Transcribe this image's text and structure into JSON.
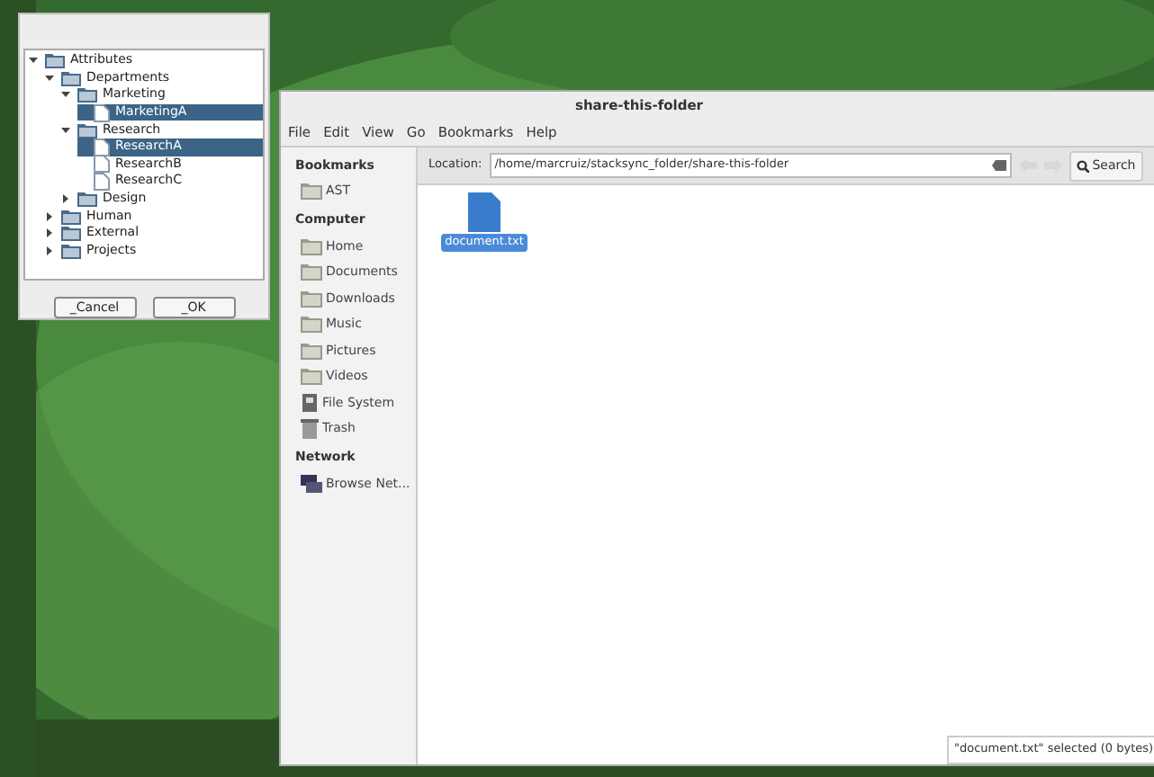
{
  "tree_dialog": {
    "tree": [
      {
        "label": "Attributes",
        "kind": "folder",
        "expanded": true,
        "selected": false,
        "children": [
          {
            "label": "Departments",
            "kind": "folder",
            "expanded": true,
            "selected": false,
            "children": [
              {
                "label": "Marketing",
                "kind": "folder",
                "expanded": true,
                "selected": false,
                "children": [
                  {
                    "label": "MarketingA",
                    "kind": "file",
                    "selected": true
                  }
                ]
              },
              {
                "label": "Research",
                "kind": "folder",
                "expanded": true,
                "selected": false,
                "children": [
                  {
                    "label": "ResearchA",
                    "kind": "file",
                    "selected": true
                  },
                  {
                    "label": "ResearchB",
                    "kind": "file",
                    "selected": false
                  },
                  {
                    "label": "ResearchC",
                    "kind": "file",
                    "selected": false
                  }
                ]
              },
              {
                "label": "Design",
                "kind": "folder",
                "expanded": false,
                "selected": false
              }
            ]
          },
          {
            "label": "Human",
            "kind": "folder",
            "expanded": false,
            "selected": false
          },
          {
            "label": "External",
            "kind": "folder",
            "expanded": false,
            "selected": false
          },
          {
            "label": "Projects",
            "kind": "folder",
            "expanded": false,
            "selected": false
          }
        ]
      }
    ],
    "buttons": [
      "_Cancel",
      "_OK"
    ]
  },
  "file_manager": {
    "title": "share-this-folder",
    "menu": [
      "File",
      "Edit",
      "View",
      "Go",
      "Bookmarks",
      "Help"
    ],
    "sidebar": [
      {
        "heading": "Bookmarks",
        "items": [
          {
            "label": "AST",
            "kind": "folder"
          }
        ]
      },
      {
        "heading": "Computer",
        "items": [
          {
            "label": "Home",
            "kind": "folder"
          },
          {
            "label": "Documents",
            "kind": "folder"
          },
          {
            "label": "Downloads",
            "kind": "folder"
          },
          {
            "label": "Music",
            "kind": "folder"
          },
          {
            "label": "Pictures",
            "kind": "folder"
          },
          {
            "label": "Videos",
            "kind": "folder"
          },
          {
            "label": "File System",
            "kind": "drive"
          },
          {
            "label": "Trash",
            "kind": "trash"
          }
        ]
      },
      {
        "heading": "Network",
        "items": [
          {
            "label": "Browse Net...",
            "kind": "network"
          }
        ]
      }
    ],
    "location_label": "Location:",
    "location": "/home/marcruiz/stacksync_folder/share-this-folder",
    "search": "Search",
    "files": [
      {
        "name": "document.txt",
        "selected": true
      }
    ],
    "status": "\"document.txt\" selected (0 bytes)"
  }
}
